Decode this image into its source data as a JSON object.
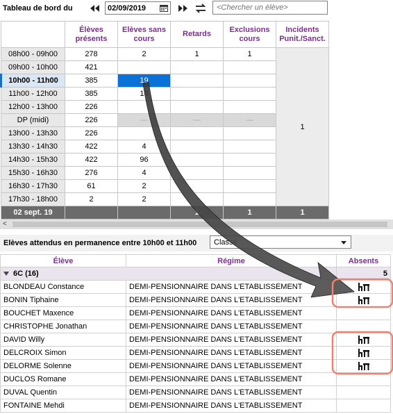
{
  "toolbar": {
    "title": "Tableau de bord du",
    "date": "02/09/2019",
    "search_placeholder": "<Chercher un élève>"
  },
  "summary_table": {
    "columns": [
      "Élèves présents",
      "Elèves sans cours",
      "Retards",
      "Exclusions cours",
      "Incidents Punit./Sanct."
    ],
    "rows": [
      {
        "time": "08h00 - 09h00",
        "presents": "278",
        "sans_cours": "2",
        "retards": "1",
        "exclusions": "1"
      },
      {
        "time": "09h00 - 10h00",
        "presents": "421",
        "sans_cours": "",
        "retards": "",
        "exclusions": ""
      },
      {
        "time": "10h00 - 11h00",
        "presents": "385",
        "sans_cours": "19",
        "retards": "",
        "exclusions": ""
      },
      {
        "time": "11h00 - 12h00",
        "presents": "385",
        "sans_cours": "18",
        "retards": "",
        "exclusions": ""
      },
      {
        "time": "12h00 - 13h00",
        "presents": "226",
        "sans_cours": "",
        "retards": "",
        "exclusions": ""
      },
      {
        "time": "DP (midi)",
        "presents": "226",
        "sans_cours": "—",
        "retards": "—",
        "exclusions": "—"
      },
      {
        "time": "13h00 - 13h30",
        "presents": "226",
        "sans_cours": "",
        "retards": "",
        "exclusions": ""
      },
      {
        "time": "13h30 - 14h30",
        "presents": "422",
        "sans_cours": "4",
        "retards": "",
        "exclusions": ""
      },
      {
        "time": "14h30 - 15h30",
        "presents": "422",
        "sans_cours": "96",
        "retards": "",
        "exclusions": ""
      },
      {
        "time": "15h30 - 16h30",
        "presents": "276",
        "sans_cours": "4",
        "retards": "",
        "exclusions": ""
      },
      {
        "time": "16h30 - 17h30",
        "presents": "61",
        "sans_cours": "2",
        "retards": "",
        "exclusions": ""
      },
      {
        "time": "17h30 - 18h00",
        "presents": "2",
        "sans_cours": "2",
        "retards": "",
        "exclusions": ""
      }
    ],
    "incidents_value": "1",
    "footer": {
      "label": "02 sept. 19",
      "presents": "",
      "sans_cours": "",
      "retards": "1",
      "exclusions": "1",
      "incidents": "1"
    }
  },
  "permanence": {
    "label": "Elèves attendus en permanence entre 10h00 et 11h00",
    "select_value": "Classe"
  },
  "students_table": {
    "columns": [
      "Élève",
      "Régime",
      "Absents"
    ],
    "group": {
      "name": "6C (16)",
      "count": "5"
    },
    "rows": [
      {
        "name": "BLONDEAU Constance",
        "regime": "DEMI-PENSIONNAIRE DANS L'ETABLISSEMENT",
        "absent": true
      },
      {
        "name": "BONIN Tiphaine",
        "regime": "DEMI-PENSIONNAIRE DANS L'ETABLISSEMENT",
        "absent": true
      },
      {
        "name": "BOUCHET Maxence",
        "regime": "DEMI-PENSIONNAIRE DANS L'ETABLISSEMENT",
        "absent": false
      },
      {
        "name": "CHRISTOPHE Jonathan",
        "regime": "DEMI-PENSIONNAIRE DANS L'ETABLISSEMENT",
        "absent": false
      },
      {
        "name": "DAVID Willy",
        "regime": "DEMI-PENSIONNAIRE DANS L'ETABLISSEMENT",
        "absent": true
      },
      {
        "name": "DELCROIX Simon",
        "regime": "DEMI-PENSIONNAIRE DANS L'ETABLISSEMENT",
        "absent": true
      },
      {
        "name": "DELORME Solenne",
        "regime": "DEMI-PENSIONNAIRE DANS L'ETABLISSEMENT",
        "absent": true
      },
      {
        "name": "DUCLOS Romane",
        "regime": "DEMI-PENSIONNAIRE DANS L'ETABLISSEMENT",
        "absent": false
      },
      {
        "name": "DUVAL Quentin",
        "regime": "DEMI-PENSIONNAIRE DANS L'ETABLISSEMENT",
        "absent": false
      },
      {
        "name": "FONTAINE Mehdi",
        "regime": "DEMI-PENSIONNAIRE DANS L'ETABLISSEMENT",
        "absent": false
      }
    ],
    "absent_icon": "desk-chair-icon"
  },
  "colors": {
    "header_text": "#7a2f8a",
    "selected_cell": "#0a72d6",
    "highlight_box": "#f08070",
    "arrow": "#555555"
  }
}
